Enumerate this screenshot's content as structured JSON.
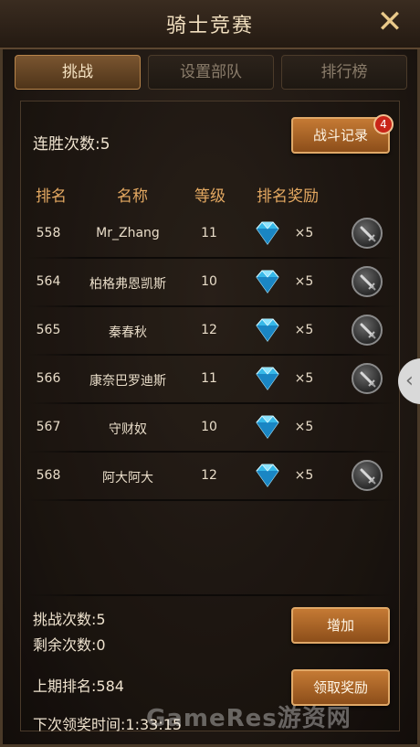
{
  "title": "骑士竞赛",
  "close_glyph": "✕",
  "tabs": [
    {
      "label": "挑战",
      "active": true
    },
    {
      "label": "设置部队",
      "active": false
    },
    {
      "label": "排行榜",
      "active": false
    }
  ],
  "streak_text": "连胜次数:5",
  "battle_record": {
    "label": "战斗记录",
    "badge": "4"
  },
  "table_headers": {
    "rank": "排名",
    "name": "名称",
    "level": "等级",
    "reward": "排名奖励"
  },
  "rows": [
    {
      "rank": "558",
      "name": "Mr_Zhang",
      "level": "11",
      "reward_icon": "diamond-icon",
      "reward_qty": "×5",
      "challenge": true
    },
    {
      "rank": "564",
      "name": "柏格弗恩凯斯",
      "level": "10",
      "reward_icon": "diamond-icon",
      "reward_qty": "×5",
      "challenge": true
    },
    {
      "rank": "565",
      "name": "秦春秋",
      "level": "12",
      "reward_icon": "diamond-icon",
      "reward_qty": "×5",
      "challenge": true
    },
    {
      "rank": "566",
      "name": "康奈巴罗迪斯",
      "level": "11",
      "reward_icon": "diamond-icon",
      "reward_qty": "×5",
      "challenge": true
    },
    {
      "rank": "567",
      "name": "守财奴",
      "level": "10",
      "reward_icon": "diamond-icon",
      "reward_qty": "×5",
      "challenge": false
    },
    {
      "rank": "568",
      "name": "阿大阿大",
      "level": "12",
      "reward_icon": "diamond-icon",
      "reward_qty": "×5",
      "challenge": true
    }
  ],
  "challenge_count": "挑战次数:5",
  "remaining_count": "剩余次数:0",
  "add_button": "增加",
  "last_rank": "上期排名:584",
  "claim_button": "领取奖励",
  "next_reward_time": "下次领奖时间:1:33:15",
  "watermark": "GameRes游资网",
  "side_arrow": "‹",
  "colors": {
    "accent": "#e3a861",
    "button": "#b36a2a",
    "badge": "#c92418"
  }
}
